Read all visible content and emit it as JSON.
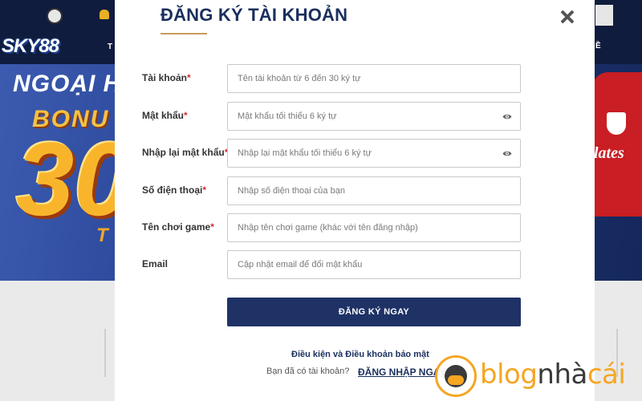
{
  "background": {
    "logo_text": "SKY88",
    "nav_partial_left": "T",
    "nav_partial_right": "Ề",
    "banner": {
      "title": "NGOẠI H",
      "bonus": "BONU",
      "big_number": "30",
      "small_text": "T",
      "sponsor": "lates"
    }
  },
  "modal": {
    "title": "ĐĂNG KÝ TÀI KHOẢN",
    "fields": [
      {
        "label": "Tài khoản",
        "required": "*",
        "placeholder": "Tên tài khoản từ 6 đến 30 ký tự",
        "value": ""
      },
      {
        "label": "Mật khẩu",
        "required": "*",
        "placeholder": "Mật khẩu tối thiểu 6 ký tự",
        "value": ""
      },
      {
        "label": "Nhập lại mật khẩu",
        "required": "*",
        "placeholder": "Nhập lại mật khẩu tối thiểu 6 ký tự",
        "value": ""
      },
      {
        "label": "Số điện thoại",
        "required": "*",
        "placeholder": "Nhập số điện thoại của bạn",
        "value": ""
      },
      {
        "label": "Tên chơi game",
        "required": "*",
        "placeholder": "Nhập tên chơi game (khác với tên đăng nhập)",
        "value": ""
      },
      {
        "label": "Email",
        "required": "",
        "placeholder": "Cập nhật email để đổi mật khẩu",
        "value": ""
      }
    ],
    "submit_label": "ĐĂNG KÝ NGAY",
    "terms_link": "Điều kiện và Điều khoản bảo mật",
    "have_account_text": "Bạn đã có tài khoản?",
    "login_link": "ĐĂNG NHẬP NGAY"
  },
  "watermark": {
    "text_orange": "blog",
    "text_dark": "nhà",
    "text_orange2": "cái"
  },
  "colors": {
    "modal_title": "#1a2f5e",
    "submit_bg": "#1f3266",
    "required": "#d32f2f",
    "accent_underline": "#c89b5a",
    "watermark": "#f5a623"
  },
  "icons": [
    "close-icon",
    "eye-icon",
    "bell-icon",
    "logo-ball-icon"
  ]
}
